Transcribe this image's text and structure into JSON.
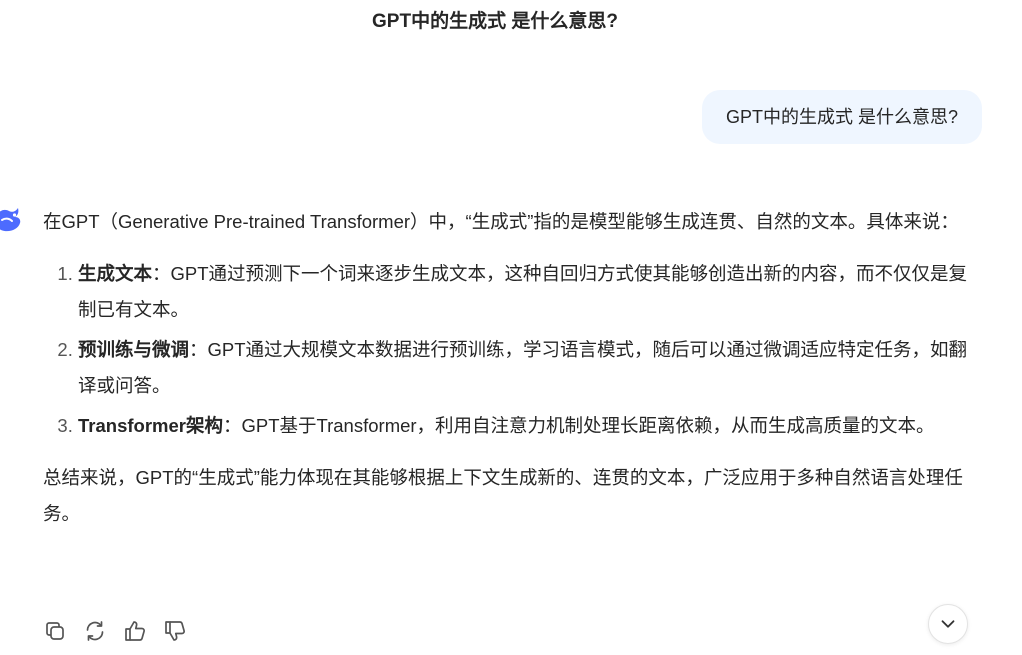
{
  "header": {
    "title": "GPT中的生成式 是什么意思?"
  },
  "user_message": {
    "text": "GPT中的生成式 是什么意思?"
  },
  "assistant": {
    "avatar_icon": "assistant-logo-icon",
    "intro": "在GPT（Generative Pre-trained Transformer）中，“生成式”指的是模型能够生成连贯、自然的文本。具体来说：",
    "items": [
      {
        "title": "生成文本",
        "text": "：GPT通过预测下一个词来逐步生成文本，这种自回归方式使其能够创造出新的内容，而不仅仅是复制已有文本。"
      },
      {
        "title": "预训练与微调",
        "text": "：GPT通过大规模文本数据进行预训练，学习语言模式，随后可以通过微调适应特定任务，如翻译或问答。"
      },
      {
        "title": "Transformer架构",
        "text": "：GPT基于Transformer，利用自注意力机制处理长距离依赖，从而生成高质量的文本。"
      }
    ],
    "summary": "总结来说，GPT的“生成式”能力体现在其能够根据上下文生成新的、连贯的文本，广泛应用于多种自然语言处理任务。"
  },
  "actions": {
    "icons": [
      "copy-icon",
      "regenerate-icon",
      "thumbs-up-icon",
      "thumbs-down-icon"
    ]
  },
  "scroll": {
    "icon": "chevron-down-icon"
  },
  "colors": {
    "user_bubble_bg": "#eff6ff",
    "text": "#262626",
    "icon": "#555555",
    "brand": "#4d6bfe"
  }
}
